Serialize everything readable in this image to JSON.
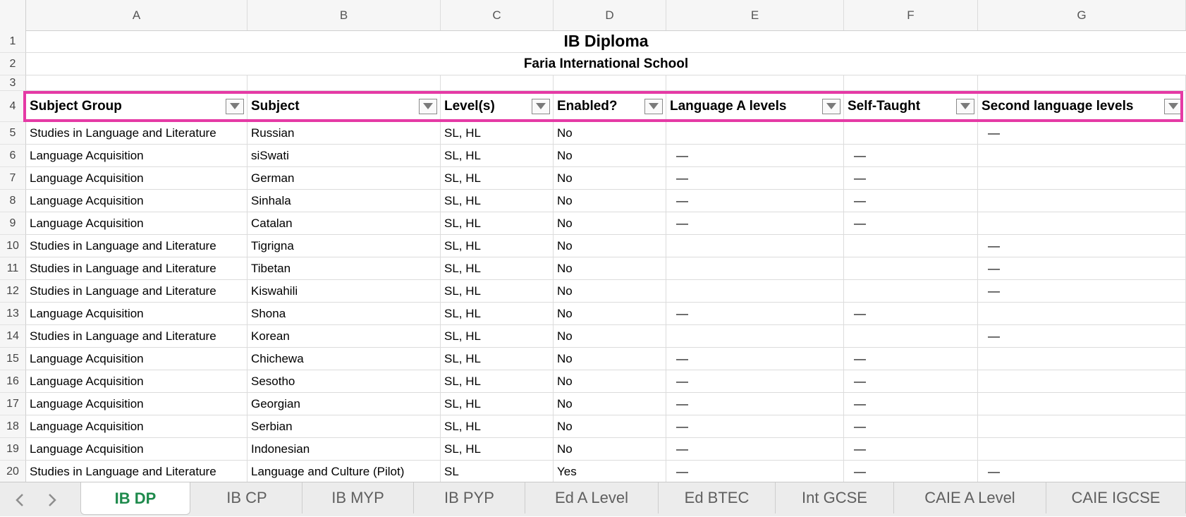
{
  "columns": [
    "A",
    "B",
    "C",
    "D",
    "E",
    "F",
    "G"
  ],
  "title": "IB Diploma",
  "subtitle": "Faria International School",
  "headers": [
    "Subject Group",
    "Subject",
    "Level(s)",
    "Enabled?",
    "Language A levels",
    "Self-Taught",
    "Second language levels"
  ],
  "rows": [
    {
      "num": "5",
      "a": "Studies in Language and Literature",
      "b": "Russian",
      "c": "SL, HL",
      "d": "No",
      "e": "",
      "f": "",
      "g": "—"
    },
    {
      "num": "6",
      "a": "Language Acquisition",
      "b": "siSwati",
      "c": "SL, HL",
      "d": "No",
      "e": "—",
      "f": "—",
      "g": ""
    },
    {
      "num": "7",
      "a": "Language Acquisition",
      "b": "German",
      "c": "SL, HL",
      "d": "No",
      "e": "—",
      "f": "—",
      "g": ""
    },
    {
      "num": "8",
      "a": "Language Acquisition",
      "b": "Sinhala",
      "c": "SL, HL",
      "d": "No",
      "e": "—",
      "f": "—",
      "g": ""
    },
    {
      "num": "9",
      "a": "Language Acquisition",
      "b": "Catalan",
      "c": "SL, HL",
      "d": "No",
      "e": "—",
      "f": "—",
      "g": ""
    },
    {
      "num": "10",
      "a": "Studies in Language and Literature",
      "b": "Tigrigna",
      "c": "SL, HL",
      "d": "No",
      "e": "",
      "f": "",
      "g": "—"
    },
    {
      "num": "11",
      "a": "Studies in Language and Literature",
      "b": "Tibetan",
      "c": "SL, HL",
      "d": "No",
      "e": "",
      "f": "",
      "g": "—"
    },
    {
      "num": "12",
      "a": "Studies in Language and Literature",
      "b": "Kiswahili",
      "c": "SL, HL",
      "d": "No",
      "e": "",
      "f": "",
      "g": "—"
    },
    {
      "num": "13",
      "a": "Language Acquisition",
      "b": "Shona",
      "c": "SL, HL",
      "d": "No",
      "e": "—",
      "f": "—",
      "g": ""
    },
    {
      "num": "14",
      "a": "Studies in Language and Literature",
      "b": "Korean",
      "c": "SL, HL",
      "d": "No",
      "e": "",
      "f": "",
      "g": "—"
    },
    {
      "num": "15",
      "a": "Language Acquisition",
      "b": "Chichewa",
      "c": "SL, HL",
      "d": "No",
      "e": "—",
      "f": "—",
      "g": ""
    },
    {
      "num": "16",
      "a": "Language Acquisition",
      "b": "Sesotho",
      "c": "SL, HL",
      "d": "No",
      "e": "—",
      "f": "—",
      "g": ""
    },
    {
      "num": "17",
      "a": "Language Acquisition",
      "b": "Georgian",
      "c": "SL, HL",
      "d": "No",
      "e": "—",
      "f": "—",
      "g": ""
    },
    {
      "num": "18",
      "a": "Language Acquisition",
      "b": "Serbian",
      "c": "SL, HL",
      "d": "No",
      "e": "—",
      "f": "—",
      "g": ""
    },
    {
      "num": "19",
      "a": "Language Acquisition",
      "b": "Indonesian",
      "c": "SL, HL",
      "d": "No",
      "e": "—",
      "f": "—",
      "g": ""
    },
    {
      "num": "20",
      "a": "Studies in Language and Literature",
      "b": "Language and Culture (Pilot)",
      "c": "SL",
      "d": "Yes",
      "e": "—",
      "f": "—",
      "g": "—"
    }
  ],
  "tabs": [
    "IB DP",
    "IB CP",
    "IB MYP",
    "IB PYP",
    "Ed A Level",
    "Ed BTEC",
    "Int GCSE",
    "CAIE A Level",
    "CAIE IGCSE"
  ],
  "active_tab": "IB DP",
  "colors": {
    "highlight": "#e53aa5",
    "active_tab": "#1e8a4c"
  }
}
